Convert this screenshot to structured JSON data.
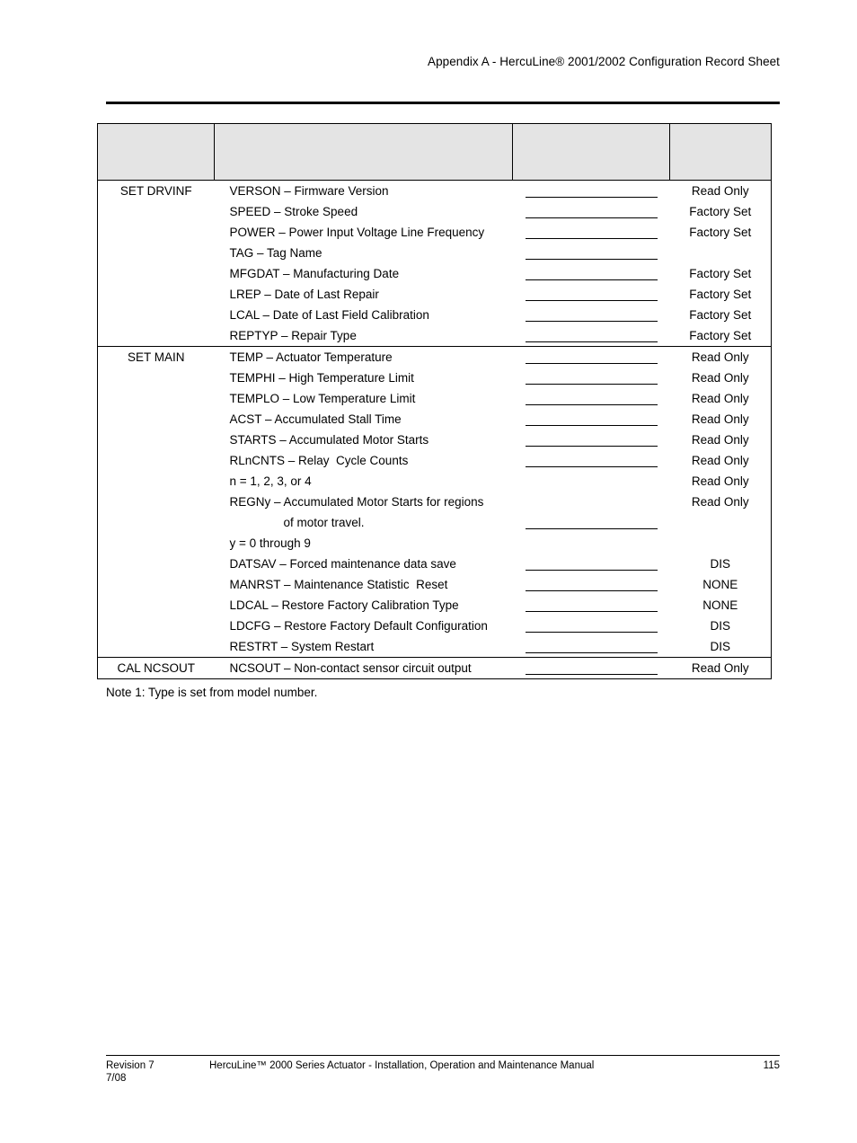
{
  "header": {
    "running_head": "Appendix A - HercuLine® 2001/2002 Configuration Record Sheet"
  },
  "table": {
    "columns": [
      "",
      "",
      "",
      ""
    ],
    "sections": [
      {
        "menu": "SET DRVINF",
        "rows": [
          {
            "parameter": "VERSON – Firmware Version",
            "value_line": true,
            "status": "Read Only"
          },
          {
            "parameter": "SPEED – Stroke Speed",
            "value_line": true,
            "status": "Factory Set"
          },
          {
            "parameter": "POWER – Power Input Voltage Line Frequency",
            "value_line": true,
            "status": "Factory Set"
          },
          {
            "parameter": "TAG – Tag Name",
            "value_line": true,
            "status": ""
          },
          {
            "parameter": "MFGDAT – Manufacturing Date",
            "value_line": true,
            "status": "Factory Set"
          },
          {
            "parameter": "LREP – Date of Last Repair",
            "value_line": true,
            "status": "Factory Set"
          },
          {
            "parameter": "LCAL – Date of Last Field Calibration",
            "value_line": true,
            "status": "Factory Set"
          },
          {
            "parameter": "REPTYP – Repair Type",
            "value_line": true,
            "status": "Factory Set"
          }
        ]
      },
      {
        "menu": "SET MAIN",
        "rows": [
          {
            "parameter": "TEMP – Actuator Temperature",
            "value_line": true,
            "status": "Read Only"
          },
          {
            "parameter": "TEMPHI – High Temperature Limit",
            "value_line": true,
            "status": "Read Only"
          },
          {
            "parameter": "TEMPLO – Low Temperature Limit",
            "value_line": true,
            "status": "Read Only"
          },
          {
            "parameter": "ACST – Accumulated Stall Time",
            "value_line": true,
            "status": "Read Only"
          },
          {
            "parameter": "STARTS – Accumulated Motor Starts",
            "value_line": true,
            "status": "Read Only"
          },
          {
            "parameter": "RLnCNTS – Relay  Cycle Counts",
            "value_line": true,
            "status": "Read Only"
          },
          {
            "parameter": "n = 1, 2, 3, or 4",
            "value_line": false,
            "status": "Read Only"
          },
          {
            "parameter": "REGNy – Accumulated Motor Starts for regions",
            "continuation": "of motor travel.",
            "value_line": true,
            "status": "Read Only"
          },
          {
            "parameter": "y = 0 through 9",
            "value_line": false,
            "status": ""
          },
          {
            "parameter": "DATSAV – Forced maintenance data save",
            "value_line": true,
            "status": "DIS"
          },
          {
            "parameter": "MANRST – Maintenance Statistic  Reset",
            "value_line": true,
            "status": "NONE"
          },
          {
            "parameter": "LDCAL – Restore Factory Calibration Type",
            "value_line": true,
            "status": "NONE"
          },
          {
            "parameter": "LDCFG – Restore Factory Default Configuration",
            "value_line": true,
            "status": "DIS"
          },
          {
            "parameter": "RESTRT – System Restart",
            "value_line": true,
            "status": "DIS"
          }
        ]
      },
      {
        "menu": "CAL NCSOUT",
        "bordered_top": false,
        "rows": [
          {
            "parameter": "NCSOUT – Non-contact sensor circuit output",
            "value_line": true,
            "status": "Read Only"
          }
        ]
      }
    ]
  },
  "note": "Note 1: Type is set from model number.",
  "footer": {
    "revision": "Revision 7\n7/08",
    "manual_title": "HercuLine™ 2000 Series Actuator - Installation, Operation and Maintenance Manual",
    "page_number": "115"
  },
  "colors": {
    "header_band": "#e4e4e4",
    "rule": "#000000",
    "text": "#000000"
  }
}
